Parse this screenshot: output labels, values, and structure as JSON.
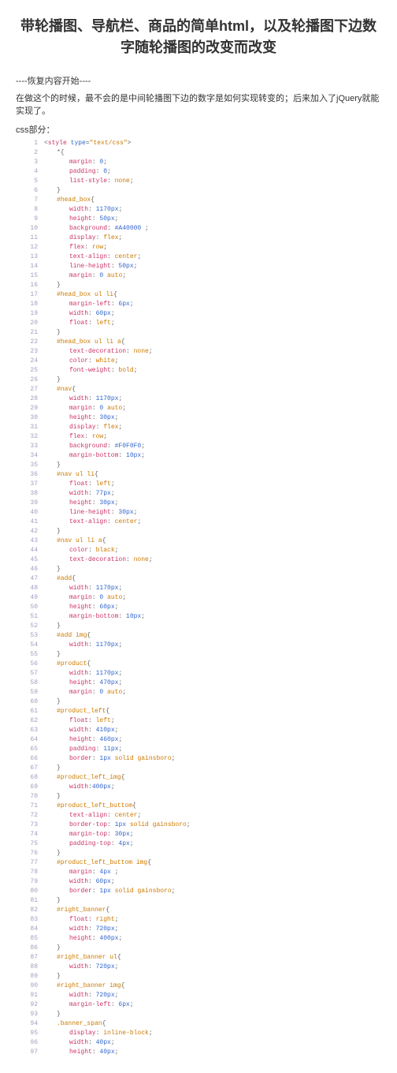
{
  "title": "带轮播图、导航栏、商品的简单html，以及轮播图下边数字随轮播图的改变而改变",
  "note": "----恢复内容开始----",
  "desc": "在做这个的时候，最不会的是中间轮播图下边的数字是如何实现转变的；后来加入了jQuery就能实现了。",
  "section": "css部分：",
  "lines": [
    {
      "n": "1",
      "html": "<span class='punct'>&lt;</span><span class='tag'>style</span> <span class='attr'>type</span><span class='punct'>=</span><span class='val'>\"text/css\"</span><span class='punct'>&gt;</span>"
    },
    {
      "n": "2",
      "html": "<span class='ind1'></span><span class='punct'>*{</span>"
    },
    {
      "n": "3",
      "html": "<span class='ind2'></span><span class='prop'>margin</span><span class='punct'>: </span><span class='num'>0</span><span class='punct'>;</span>"
    },
    {
      "n": "4",
      "html": "<span class='ind2'></span><span class='prop'>padding</span><span class='punct'>: </span><span class='num'>0</span><span class='punct'>;</span>"
    },
    {
      "n": "5",
      "html": "<span class='ind2'></span><span class='prop'>list-style</span><span class='punct'>: </span><span class='val'>none</span><span class='punct'>;</span>"
    },
    {
      "n": "6",
      "html": "<span class='ind1'></span><span class='punct'>}</span>"
    },
    {
      "n": "7",
      "html": "<span class='ind1'></span><span class='sel'>#head_box</span><span class='punct'>{</span>"
    },
    {
      "n": "8",
      "html": "<span class='ind2'></span><span class='prop'>width</span><span class='punct'>: </span><span class='num'>1170px</span><span class='punct'>;</span>"
    },
    {
      "n": "9",
      "html": "<span class='ind2'></span><span class='prop'>height</span><span class='punct'>: </span><span class='num'>50px</span><span class='punct'>;</span>"
    },
    {
      "n": "10",
      "html": "<span class='ind2'></span><span class='prop'>background</span><span class='punct'>: </span><span class='num'>#A40000</span><span class='punct'> ;</span>"
    },
    {
      "n": "11",
      "html": "<span class='ind2'></span><span class='prop'>display</span><span class='punct'>: </span><span class='val'>flex</span><span class='punct'>;</span>"
    },
    {
      "n": "12",
      "html": "<span class='ind2'></span><span class='prop'>flex</span><span class='punct'>: </span><span class='val'>row</span><span class='punct'>;</span>"
    },
    {
      "n": "13",
      "html": "<span class='ind2'></span><span class='prop'>text-align</span><span class='punct'>: </span><span class='val'>center</span><span class='punct'>;</span>"
    },
    {
      "n": "14",
      "html": "<span class='ind2'></span><span class='prop'>line-height</span><span class='punct'>: </span><span class='num'>50px</span><span class='punct'>;</span>"
    },
    {
      "n": "15",
      "html": "<span class='ind2'></span><span class='prop'>margin</span><span class='punct'>: </span><span class='num'>0</span> <span class='val'>auto</span><span class='punct'>;</span>"
    },
    {
      "n": "16",
      "html": "<span class='ind1'></span><span class='punct'>}</span>"
    },
    {
      "n": "17",
      "html": "<span class='ind1'></span><span class='sel'>#head_box ul li</span><span class='punct'>{</span>"
    },
    {
      "n": "18",
      "html": "<span class='ind2'></span><span class='prop'>margin-left</span><span class='punct'>: </span><span class='num'>6px</span><span class='punct'>;</span>"
    },
    {
      "n": "19",
      "html": "<span class='ind2'></span><span class='prop'>width</span><span class='punct'>: </span><span class='num'>60px</span><span class='punct'>;</span>"
    },
    {
      "n": "20",
      "html": "<span class='ind2'></span><span class='prop'>float</span><span class='punct'>: </span><span class='val'>left</span><span class='punct'>;</span>"
    },
    {
      "n": "21",
      "html": "<span class='ind1'></span><span class='punct'>}</span>"
    },
    {
      "n": "22",
      "html": "<span class='ind1'></span><span class='sel'>#head_box ul li a</span><span class='punct'>{</span>"
    },
    {
      "n": "23",
      "html": "<span class='ind2'></span><span class='prop'>text-decoration</span><span class='punct'>: </span><span class='val'>none</span><span class='punct'>;</span>"
    },
    {
      "n": "24",
      "html": "<span class='ind2'></span><span class='prop'>color</span><span class='punct'>: </span><span class='val'>white</span><span class='punct'>;</span>"
    },
    {
      "n": "25",
      "html": "<span class='ind2'></span><span class='prop'>font-weight</span><span class='punct'>: </span><span class='val'>bold</span><span class='punct'>;</span>"
    },
    {
      "n": "26",
      "html": "<span class='ind1'></span><span class='punct'>}</span>"
    },
    {
      "n": "27",
      "html": "<span class='ind1'></span><span class='sel'>#nav</span><span class='punct'>{</span>"
    },
    {
      "n": "28",
      "html": "<span class='ind2'></span><span class='prop'>width</span><span class='punct'>: </span><span class='num'>1170px</span><span class='punct'>;</span>"
    },
    {
      "n": "29",
      "html": "<span class='ind2'></span><span class='prop'>margin</span><span class='punct'>: </span><span class='num'>0</span> <span class='val'>auto</span><span class='punct'>;</span>"
    },
    {
      "n": "30",
      "html": "<span class='ind2'></span><span class='prop'>height</span><span class='punct'>: </span><span class='num'>30px</span><span class='punct'>;</span>"
    },
    {
      "n": "31",
      "html": "<span class='ind2'></span><span class='prop'>display</span><span class='punct'>: </span><span class='val'>flex</span><span class='punct'>;</span>"
    },
    {
      "n": "32",
      "html": "<span class='ind2'></span><span class='prop'>flex</span><span class='punct'>: </span><span class='val'>row</span><span class='punct'>;</span>"
    },
    {
      "n": "33",
      "html": "<span class='ind2'></span><span class='prop'>background</span><span class='punct'>: </span><span class='num'>#F0F0F0</span><span class='punct'>;</span>"
    },
    {
      "n": "34",
      "html": "<span class='ind2'></span><span class='prop'>margin-bottom</span><span class='punct'>: </span><span class='num'>10px</span><span class='punct'>;</span>"
    },
    {
      "n": "35",
      "html": "<span class='ind1'></span><span class='punct'>}</span>"
    },
    {
      "n": "36",
      "html": "<span class='ind1'></span><span class='sel'>#nav ul li</span><span class='punct'>{</span>"
    },
    {
      "n": "37",
      "html": "<span class='ind2'></span><span class='prop'>float</span><span class='punct'>: </span><span class='val'>left</span><span class='punct'>;</span>"
    },
    {
      "n": "38",
      "html": "<span class='ind2'></span><span class='prop'>width</span><span class='punct'>: </span><span class='num'>77px</span><span class='punct'>;</span>"
    },
    {
      "n": "39",
      "html": "<span class='ind2'></span><span class='prop'>height</span><span class='punct'>: </span><span class='num'>30px</span><span class='punct'>;</span>"
    },
    {
      "n": "40",
      "html": "<span class='ind2'></span><span class='prop'>line-height</span><span class='punct'>: </span><span class='num'>30px</span><span class='punct'>;</span>"
    },
    {
      "n": "41",
      "html": "<span class='ind2'></span><span class='prop'>text-align</span><span class='punct'>: </span><span class='val'>center</span><span class='punct'>;</span>"
    },
    {
      "n": "42",
      "html": "<span class='ind1'></span><span class='punct'>}</span>"
    },
    {
      "n": "43",
      "html": "<span class='ind1'></span><span class='sel'>#nav ul li a</span><span class='punct'>{</span>"
    },
    {
      "n": "44",
      "html": "<span class='ind2'></span><span class='prop'>color</span><span class='punct'>: </span><span class='val'>black</span><span class='punct'>;</span>"
    },
    {
      "n": "45",
      "html": "<span class='ind2'></span><span class='prop'>text-decoration</span><span class='punct'>: </span><span class='val'>none</span><span class='punct'>;</span>"
    },
    {
      "n": "46",
      "html": "<span class='ind1'></span><span class='punct'>}</span>"
    },
    {
      "n": "47",
      "html": "<span class='ind1'></span><span class='sel'>#add</span><span class='punct'>{</span>"
    },
    {
      "n": "48",
      "html": "<span class='ind2'></span><span class='prop'>width</span><span class='punct'>: </span><span class='num'>1170px</span><span class='punct'>;</span>"
    },
    {
      "n": "49",
      "html": "<span class='ind2'></span><span class='prop'>margin</span><span class='punct'>: </span><span class='num'>0</span> <span class='val'>auto</span><span class='punct'>;</span>"
    },
    {
      "n": "50",
      "html": "<span class='ind2'></span><span class='prop'>height</span><span class='punct'>: </span><span class='num'>60px</span><span class='punct'>;</span>"
    },
    {
      "n": "51",
      "html": "<span class='ind2'></span><span class='prop'>margin-bottom</span><span class='punct'>: </span><span class='num'>10px</span><span class='punct'>;</span>"
    },
    {
      "n": "52",
      "html": "<span class='ind1'></span><span class='punct'>}</span>"
    },
    {
      "n": "53",
      "html": "<span class='ind1'></span><span class='sel'>#add img</span><span class='punct'>{</span>"
    },
    {
      "n": "54",
      "html": "<span class='ind2'></span><span class='prop'>width</span><span class='punct'>: </span><span class='num'>1170px</span><span class='punct'>;</span>"
    },
    {
      "n": "55",
      "html": "<span class='ind1'></span><span class='punct'>}</span>"
    },
    {
      "n": "56",
      "html": "<span class='ind1'></span><span class='sel'>#product</span><span class='punct'>{</span>"
    },
    {
      "n": "57",
      "html": "<span class='ind2'></span><span class='prop'>width</span><span class='punct'>: </span><span class='num'>1170px</span><span class='punct'>;</span>"
    },
    {
      "n": "58",
      "html": "<span class='ind2'></span><span class='prop'>height</span><span class='punct'>: </span><span class='num'>470px</span><span class='punct'>;</span>"
    },
    {
      "n": "59",
      "html": "<span class='ind2'></span><span class='prop'>margin</span><span class='punct'>: </span><span class='num'>0</span> <span class='val'>auto</span><span class='punct'>;</span>"
    },
    {
      "n": "60",
      "html": "<span class='ind1'></span><span class='punct'>}</span>"
    },
    {
      "n": "61",
      "html": "<span class='ind1'></span><span class='sel'>#product_left</span><span class='punct'>{</span>"
    },
    {
      "n": "62",
      "html": "<span class='ind2'></span><span class='prop'>float</span><span class='punct'>: </span><span class='val'>left</span><span class='punct'>;</span>"
    },
    {
      "n": "63",
      "html": "<span class='ind2'></span><span class='prop'>width</span><span class='punct'>: </span><span class='num'>410px</span><span class='punct'>;</span>"
    },
    {
      "n": "64",
      "html": "<span class='ind2'></span><span class='prop'>height</span><span class='punct'>: </span><span class='num'>460px</span><span class='punct'>;</span>"
    },
    {
      "n": "65",
      "html": "<span class='ind2'></span><span class='prop'>padding</span><span class='punct'>: </span><span class='num'>11px</span><span class='punct'>;</span>"
    },
    {
      "n": "66",
      "html": "<span class='ind2'></span><span class='prop'>border</span><span class='punct'>: </span><span class='num'>1px</span> <span class='val'>solid gainsboro</span><span class='punct'>;</span>"
    },
    {
      "n": "67",
      "html": "<span class='ind1'></span><span class='punct'>}</span>"
    },
    {
      "n": "68",
      "html": "<span class='ind1'></span><span class='sel'>#product_left_img</span><span class='punct'>{</span>"
    },
    {
      "n": "69",
      "html": "<span class='ind2'></span><span class='prop'>width</span><span class='punct'>:</span><span class='num'>400px</span><span class='punct'>;</span>"
    },
    {
      "n": "70",
      "html": "<span class='ind1'></span><span class='punct'>}</span>"
    },
    {
      "n": "71",
      "html": "<span class='ind1'></span><span class='sel'>#product_left_buttom</span><span class='punct'>{</span>"
    },
    {
      "n": "72",
      "html": "<span class='ind2'></span><span class='prop'>text-align</span><span class='punct'>: </span><span class='val'>center</span><span class='punct'>;</span>"
    },
    {
      "n": "73",
      "html": "<span class='ind2'></span><span class='prop'>border-top</span><span class='punct'>: </span><span class='num'>1px</span> <span class='val'>solid gainsboro</span><span class='punct'>;</span>"
    },
    {
      "n": "74",
      "html": "<span class='ind2'></span><span class='prop'>margin-top</span><span class='punct'>: </span><span class='num'>30px</span><span class='punct'>;</span>"
    },
    {
      "n": "75",
      "html": "<span class='ind2'></span><span class='prop'>padding-top</span><span class='punct'>: </span><span class='num'>4px</span><span class='punct'>;</span>"
    },
    {
      "n": "76",
      "html": "<span class='ind1'></span><span class='punct'>}</span>"
    },
    {
      "n": "77",
      "html": "<span class='ind1'></span><span class='sel'>#product_left_buttom img</span><span class='punct'>{</span>"
    },
    {
      "n": "78",
      "html": "<span class='ind2'></span><span class='prop'>margin</span><span class='punct'>: </span><span class='num'>4px</span><span class='punct'> ;</span>"
    },
    {
      "n": "79",
      "html": "<span class='ind2'></span><span class='prop'>width</span><span class='punct'>: </span><span class='num'>60px</span><span class='punct'>;</span>"
    },
    {
      "n": "80",
      "html": "<span class='ind2'></span><span class='prop'>border</span><span class='punct'>: </span><span class='num'>1px</span> <span class='val'>solid gainsboro</span><span class='punct'>;</span>"
    },
    {
      "n": "81",
      "html": "<span class='ind1'></span><span class='punct'>}</span>"
    },
    {
      "n": "82",
      "html": "<span class='ind1'></span><span class='sel'>#right_banner</span><span class='punct'>{</span>"
    },
    {
      "n": "83",
      "html": "<span class='ind2'></span><span class='prop'>float</span><span class='punct'>: </span><span class='val'>right</span><span class='punct'>;</span>"
    },
    {
      "n": "84",
      "html": "<span class='ind2'></span><span class='prop'>width</span><span class='punct'>: </span><span class='num'>720px</span><span class='punct'>;</span>"
    },
    {
      "n": "85",
      "html": "<span class='ind2'></span><span class='prop'>height</span><span class='punct'>: </span><span class='num'>400px</span><span class='punct'>;</span>"
    },
    {
      "n": "86",
      "html": "<span class='ind1'></span><span class='punct'>}</span>"
    },
    {
      "n": "87",
      "html": "<span class='ind1'></span><span class='sel'>#right_banner ul</span><span class='punct'>{</span>"
    },
    {
      "n": "88",
      "html": "<span class='ind2'></span><span class='prop'>width</span><span class='punct'>: </span><span class='num'>720px</span><span class='punct'>;</span>"
    },
    {
      "n": "89",
      "html": "<span class='ind1'></span><span class='punct'>}</span>"
    },
    {
      "n": "90",
      "html": "<span class='ind1'></span><span class='sel'>#right_banner img</span><span class='punct'>{</span>"
    },
    {
      "n": "91",
      "html": "<span class='ind2'></span><span class='prop'>width</span><span class='punct'>: </span><span class='num'>720px</span><span class='punct'>;</span>"
    },
    {
      "n": "92",
      "html": "<span class='ind2'></span><span class='prop'>margin-left</span><span class='punct'>: </span><span class='num'>6px</span><span class='punct'>;</span>"
    },
    {
      "n": "93",
      "html": "<span class='ind1'></span><span class='punct'>}</span>"
    },
    {
      "n": "94",
      "html": "<span class='ind1'></span><span class='sel'>.banner_span</span><span class='punct'>{</span>"
    },
    {
      "n": "95",
      "html": "<span class='ind2'></span><span class='prop'>display</span><span class='punct'>: </span><span class='val'>inline-block</span><span class='punct'>;</span>"
    },
    {
      "n": "96",
      "html": "<span class='ind2'></span><span class='prop'>width</span><span class='punct'>: </span><span class='num'>40px</span><span class='punct'>;</span>"
    },
    {
      "n": "97",
      "html": "<span class='ind2'></span><span class='prop'>height</span><span class='punct'>: </span><span class='num'>40px</span><span class='punct'>;</span>"
    }
  ]
}
